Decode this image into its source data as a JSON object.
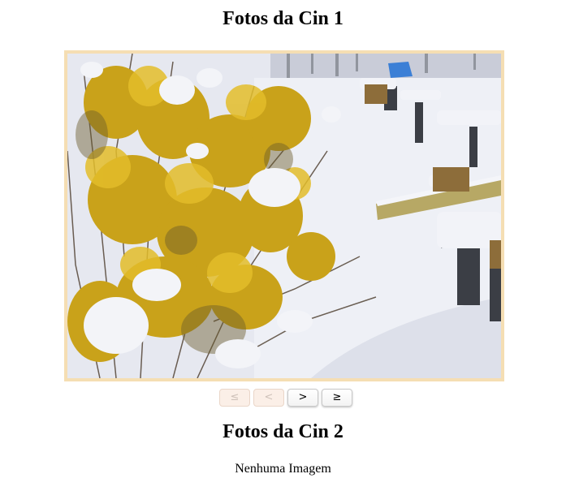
{
  "gallery1": {
    "title": "Fotos da Cin 1",
    "pager": {
      "first": "≤",
      "prev": "<",
      "next": ">",
      "last": "≥"
    }
  },
  "gallery2": {
    "title": "Fotos da Cin 2",
    "empty_message": "Nenhuma Imagem"
  },
  "colors": {
    "frame_border": "#f5deb3",
    "disabled_button_bg": "#fbefe7"
  }
}
